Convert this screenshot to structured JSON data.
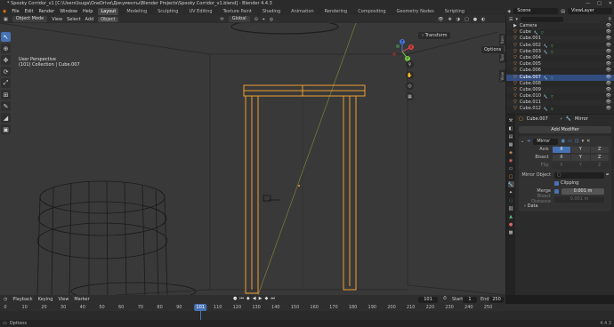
{
  "titlebar": {
    "title": "* Spooky Corridor_v1 [C:\\Users\\lsuga\\OneDrive\\Документы\\Blender Projects\\Spooky Corridor_v1.blend] - Blender 4.4.3",
    "minimize": "—",
    "maximize": "□",
    "close": "✕"
  },
  "menubar": {
    "file": "File",
    "edit": "Edit",
    "render": "Render",
    "window": "Window",
    "help": "Help",
    "workspaces": [
      "Layout",
      "Modeling",
      "Sculpting",
      "UV Editing",
      "Texture Paint",
      "Shading",
      "Animation",
      "Rendering",
      "Compositing",
      "Geometry Nodes",
      "Scripting"
    ],
    "active_workspace": "Layout",
    "scene_label": "Scene",
    "viewlayer_label": "ViewLayer"
  },
  "viewport_header": {
    "mode": "Object Mode",
    "view": "View",
    "select": "Select",
    "add": "Add",
    "object": "Object",
    "orientation": "Global"
  },
  "viewport": {
    "perspective": "User Perspective",
    "collection_info": "(101) Collection | Cube.007",
    "transform_tab": "Transform",
    "options": "Options",
    "side_tabs": [
      "Item",
      "Tool",
      "View"
    ],
    "gizmo": {
      "x": "X",
      "y": "Y",
      "z": "Z"
    }
  },
  "outliner": {
    "rows": [
      {
        "name": "Camera",
        "type": "camera"
      },
      {
        "name": "Cube",
        "type": "mesh",
        "mod": true
      },
      {
        "name": "Cube.001",
        "type": "mesh",
        "mod": false
      },
      {
        "name": "Cube.002",
        "type": "mesh",
        "mod": true
      },
      {
        "name": "Cube.003",
        "type": "mesh",
        "mod": true
      },
      {
        "name": "Cube.004",
        "type": "mesh",
        "mod": false
      },
      {
        "name": "Cube.005",
        "type": "mesh",
        "mod": false
      },
      {
        "name": "Cube.006",
        "type": "mesh",
        "mod": false
      },
      {
        "name": "Cube.007",
        "type": "mesh",
        "mod": true,
        "selected": true
      },
      {
        "name": "Cube.008",
        "type": "mesh",
        "mod": false
      },
      {
        "name": "Cube.009",
        "type": "mesh",
        "mod": false
      },
      {
        "name": "Cube.010",
        "type": "mesh",
        "mod": true
      },
      {
        "name": "Cube.011",
        "type": "mesh",
        "mod": false
      },
      {
        "name": "Cube.012",
        "type": "mesh",
        "mod": true
      }
    ]
  },
  "properties": {
    "object_name": "Cube.007",
    "modifier_context": "Mirror",
    "add_modifier": "Add Modifier",
    "modifier": {
      "name": "Mirror",
      "axis_label": "Axis",
      "bisect_label": "Bisect",
      "flip_label": "Flip",
      "axes": [
        "X",
        "Y",
        "Z"
      ],
      "mirror_object_label": "Mirror Object",
      "clipping_label": "Clipping",
      "merge_label": "Merge",
      "merge_value": "0.001 m",
      "bisect_distance_label": "Bisect Distance",
      "bisect_distance_value": "0.001 m",
      "data_label": "Data"
    }
  },
  "timeline_header": {
    "playback": "Playback",
    "keying": "Keying",
    "view": "View",
    "marker": "Marker",
    "current_frame": "101",
    "start_label": "Start",
    "start": "1",
    "end_label": "End",
    "end": "250"
  },
  "timeline": {
    "ticks": [
      "0",
      "10",
      "20",
      "30",
      "40",
      "50",
      "60",
      "70",
      "80",
      "90",
      "110",
      "120",
      "130",
      "140",
      "150",
      "160",
      "170",
      "180",
      "190",
      "200",
      "210",
      "220",
      "230",
      "240",
      "250"
    ],
    "current": "101"
  },
  "statusbar": {
    "hint": "Options",
    "version": "4.4.3"
  },
  "colors": {
    "accent": "#4772b3",
    "selection_orange": "#f0a030",
    "viewport_bg": "#393939"
  }
}
